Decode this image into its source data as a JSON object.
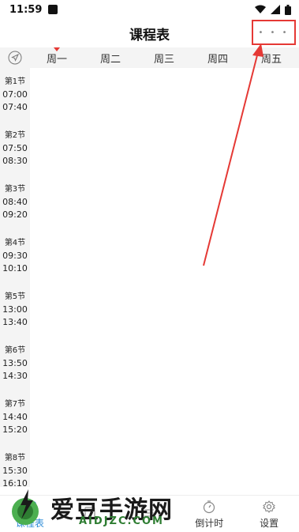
{
  "status_bar": {
    "time": "11:59"
  },
  "header": {
    "title": "课程表",
    "more_dots": "• • •"
  },
  "week_header": {
    "days": [
      {
        "label": "周一",
        "today": true
      },
      {
        "label": "周二",
        "today": false
      },
      {
        "label": "周三",
        "today": false
      },
      {
        "label": "周四",
        "today": false
      },
      {
        "label": "周五",
        "today": false
      }
    ]
  },
  "periods": [
    {
      "label": "第1节",
      "start": "07:00",
      "end": "07:40"
    },
    {
      "label": "第2节",
      "start": "07:50",
      "end": "08:30"
    },
    {
      "label": "第3节",
      "start": "08:40",
      "end": "09:20"
    },
    {
      "label": "第4节",
      "start": "09:30",
      "end": "10:10"
    },
    {
      "label": "第5节",
      "start": "13:00",
      "end": "13:40"
    },
    {
      "label": "第6节",
      "start": "13:50",
      "end": "14:30"
    },
    {
      "label": "第7节",
      "start": "14:40",
      "end": "15:20"
    },
    {
      "label": "第8节",
      "start": "15:30",
      "end": "16:10"
    }
  ],
  "tab_bar": {
    "tabs": [
      {
        "label": "课程表",
        "icon": "calendar-icon",
        "active": true
      },
      {
        "label": "",
        "icon": "book-icon",
        "active": false
      },
      {
        "label": "",
        "icon": "list-icon",
        "active": false
      },
      {
        "label": "倒计时",
        "icon": "timer-icon",
        "active": false
      },
      {
        "label": "设置",
        "icon": "gear-icon",
        "active": false
      }
    ]
  },
  "watermark": {
    "text": "爱豆手游网",
    "url": "AIDJZC.COM"
  },
  "colors": {
    "accent": "#2a8ad6",
    "highlight": "#e53935",
    "header_bg": "#f4f4f4"
  }
}
